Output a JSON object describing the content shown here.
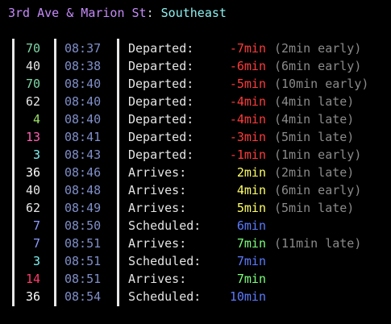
{
  "header": {
    "stop": "3rd Ave & Marion St",
    "separator": ": ",
    "direction": "Southeast"
  },
  "colors": {
    "background": "#000000",
    "stop": "#c58af9",
    "direction": "#8ff0f0",
    "time": "#7f8ec8",
    "status": "#e4e4e4",
    "note": "#8a8a8a",
    "departed": "#ff3b3b",
    "arriving": "#ffff66",
    "arrived_soon": "#7cff7c",
    "scheduled": "#5b7bff"
  },
  "rows": [
    {
      "route": "70",
      "route_color": "#7fd7a8",
      "time": "08:37",
      "status": "Departed:",
      "mins": "-7min",
      "mins_color": "#ff3b3b",
      "note": "(2min early)"
    },
    {
      "route": "40",
      "route_color": "#e6e6e6",
      "time": "08:38",
      "status": "Departed:",
      "mins": "-6min",
      "mins_color": "#ff3b3b",
      "note": "(6min early)"
    },
    {
      "route": "70",
      "route_color": "#7fd7a8",
      "time": "08:40",
      "status": "Departed:",
      "mins": "-5min",
      "mins_color": "#ff3b3b",
      "note": "(10min early)"
    },
    {
      "route": "62",
      "route_color": "#e6e6e6",
      "time": "08:40",
      "status": "Departed:",
      "mins": "-4min",
      "mins_color": "#ff3b3b",
      "note": "(4min late)"
    },
    {
      "route": "4",
      "route_color": "#9ee26a",
      "time": "08:40",
      "status": "Departed:",
      "mins": "-4min",
      "mins_color": "#ff3b3b",
      "note": "(4min late)"
    },
    {
      "route": "13",
      "route_color": "#ff5fb0",
      "time": "08:41",
      "status": "Departed:",
      "mins": "-3min",
      "mins_color": "#ff3b3b",
      "note": "(5min late)"
    },
    {
      "route": "3",
      "route_color": "#7ff0f0",
      "time": "08:43",
      "status": "Departed:",
      "mins": "-1min",
      "mins_color": "#ff3b3b",
      "note": "(1min early)"
    },
    {
      "route": "36",
      "route_color": "#ffffff",
      "time": "08:46",
      "status": "Arrives:",
      "mins": "2min",
      "mins_color": "#ffff66",
      "note": "(2min late)"
    },
    {
      "route": "40",
      "route_color": "#e6e6e6",
      "time": "08:48",
      "status": "Arrives:",
      "mins": "4min",
      "mins_color": "#ffff66",
      "note": "(6min early)"
    },
    {
      "route": "62",
      "route_color": "#e6e6e6",
      "time": "08:49",
      "status": "Arrives:",
      "mins": "5min",
      "mins_color": "#ffff66",
      "note": "(5min late)"
    },
    {
      "route": "7",
      "route_color": "#8c9cff",
      "time": "08:50",
      "status": "Scheduled:",
      "mins": "6min",
      "mins_color": "#5b7bff",
      "note": ""
    },
    {
      "route": "7",
      "route_color": "#8c9cff",
      "time": "08:51",
      "status": "Arrives:",
      "mins": "7min",
      "mins_color": "#7cff7c",
      "note": "(11min late)"
    },
    {
      "route": "3",
      "route_color": "#7ff0f0",
      "time": "08:51",
      "status": "Scheduled:",
      "mins": "7min",
      "mins_color": "#5b7bff",
      "note": ""
    },
    {
      "route": "14",
      "route_color": "#ff3b6b",
      "time": "08:51",
      "status": "Arrives:",
      "mins": "7min",
      "mins_color": "#7cff7c",
      "note": ""
    },
    {
      "route": "36",
      "route_color": "#ffffff",
      "time": "08:54",
      "status": "Scheduled:",
      "mins": "10min",
      "mins_color": "#5b7bff",
      "note": ""
    }
  ]
}
